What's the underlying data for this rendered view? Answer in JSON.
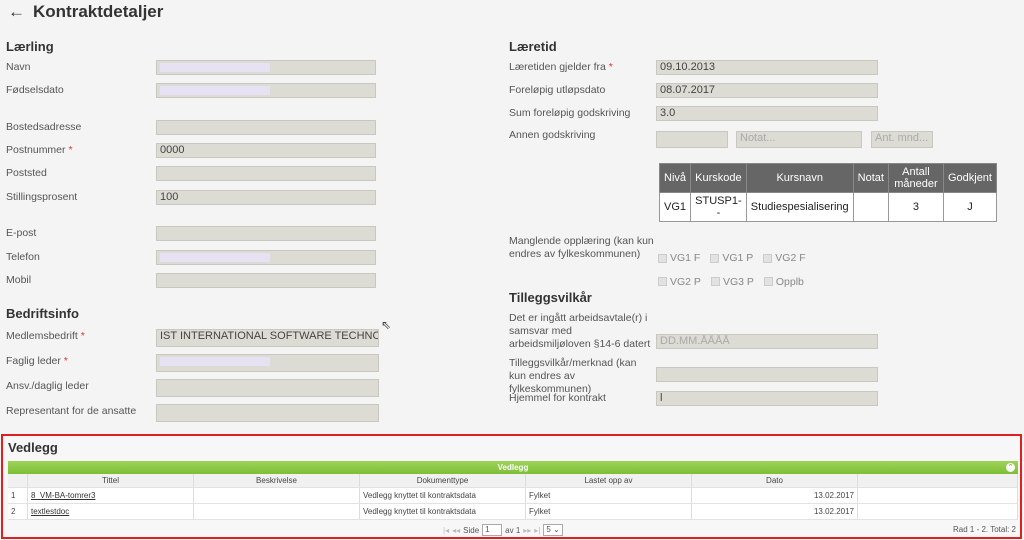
{
  "title": "Kontraktdetaljer",
  "laerling": {
    "heading": "Lærling",
    "fields": [
      {
        "label": "Navn",
        "value": "",
        "blurred": true
      },
      {
        "label": "Fødselsdato",
        "value": "",
        "blurred": true
      },
      {
        "label": "Bostedsadresse",
        "value": ""
      },
      {
        "label": "Postnummer",
        "required": true,
        "value": "0000"
      },
      {
        "label": "Poststed",
        "value": ""
      },
      {
        "label": "Stillingsprosent",
        "value": "100"
      },
      {
        "label": "E-post",
        "value": ""
      },
      {
        "label": "Telefon",
        "value": "",
        "blurred": true
      },
      {
        "label": "Mobil",
        "value": ""
      }
    ]
  },
  "bedrift": {
    "heading": "Bedriftsinfo",
    "fields": [
      {
        "label": "Medlemsbedrift",
        "required": true,
        "value": "IST INTERNATIONAL SOFTWARE TECHNO AS"
      },
      {
        "label": "Faglig leder",
        "required": true,
        "value": "",
        "blurred": true
      },
      {
        "label": "Ansv./daglig leder",
        "value": ""
      },
      {
        "label": "Representant for de ansatte",
        "value": ""
      }
    ]
  },
  "laeretid": {
    "heading": "Læretid",
    "fields": [
      {
        "label": "Læretiden gjelder fra",
        "required": true,
        "value": "09.10.2013"
      },
      {
        "label": "Foreløpig utløpsdato",
        "value": "08.07.2017"
      },
      {
        "label": "Sum foreløpig godskriving",
        "value": "3.0"
      }
    ],
    "annen": {
      "label": "Annen godskriving",
      "value": "",
      "notat_placeholder": "Notat...",
      "mnd_placeholder": "Ant. mnd..."
    },
    "course_table": {
      "headers": [
        "Nivå",
        "Kurskode",
        "Kursnavn",
        "Notat",
        "Antall måneder",
        "Godkjent"
      ],
      "rows": [
        [
          "VG1",
          "STUSP1--",
          "Studiespesialisering",
          "",
          "3",
          "J"
        ]
      ]
    },
    "manglende": {
      "label": "Manglende opplæring (kan kun endres av fylkeskommunen)",
      "options": [
        "VG1 F",
        "VG1 P",
        "VG2 F",
        "VG2 P",
        "VG3 P",
        "Opplb"
      ]
    }
  },
  "tillegg": {
    "heading": "Tilleggsvilkår",
    "avtale": {
      "label": "Det er ingått arbeidsavtale(r) i samsvar med arbeidsmiljøloven §14-6 datert",
      "placeholder": "DD.MM.ÅÅÅÅ"
    },
    "merknad": {
      "label": "Tilleggsvilkår/merknad (kan kun endres av fylkeskommunen)",
      "value": ""
    },
    "hjemmel": {
      "label": "Hjemmel for kontrakt",
      "value": "l"
    }
  },
  "vedlegg": {
    "heading": "Vedlegg",
    "grid_title": "Vedlegg",
    "columns": [
      "Tittel",
      "Beskrivelse",
      "Dokumenttype",
      "Lastet opp av",
      "Dato"
    ],
    "rows": [
      [
        "1",
        "8_VM-BA-tomrer3",
        "",
        "Vedlegg knyttet til kontraktsdata",
        "Fylket",
        "13.02.2017"
      ],
      [
        "2",
        "textlestdoc",
        "",
        "Vedlegg knyttet til kontraktsdata",
        "Fylket",
        "13.02.2017"
      ]
    ],
    "pager": {
      "side": "Side",
      "page": "1",
      "av": "av 1",
      "page_size": "5",
      "summary": "Rad 1 - 2. Total: 2"
    }
  }
}
